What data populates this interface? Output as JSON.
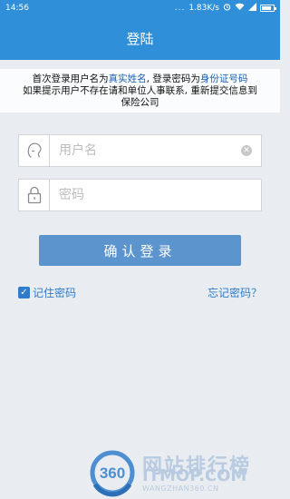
{
  "status_bar": {
    "time": "14:56",
    "dots": "...",
    "network_speed": "1.83K/s",
    "battery_level": 0.85
  },
  "header": {
    "title": "登陆"
  },
  "notice": {
    "line1_part1": "首次登录用户名为",
    "line1_highlight1": "真实姓名",
    "line1_part2": ", 登录密码为",
    "line1_highlight2": "身份证号码",
    "line2": "如果提示用户不存在请和单位人事联系, 重新提交信息到",
    "line3": "保险公司"
  },
  "form": {
    "username_placeholder": "用户名",
    "password_placeholder": "密码",
    "login_label": "确认登录",
    "remember_label": "记住密码",
    "remember_checked": true,
    "forgot_label": "忘记密码？"
  },
  "watermark": {
    "logo_text": "360",
    "title": "网站排行榜",
    "domain": "ITMOP.COM",
    "subtitle": "WANGZHAN360.CN"
  },
  "colors": {
    "primary": "#2f8fd9",
    "button": "#5c95cd",
    "link": "#2f7ccc",
    "highlight": "#1a5fb4"
  }
}
